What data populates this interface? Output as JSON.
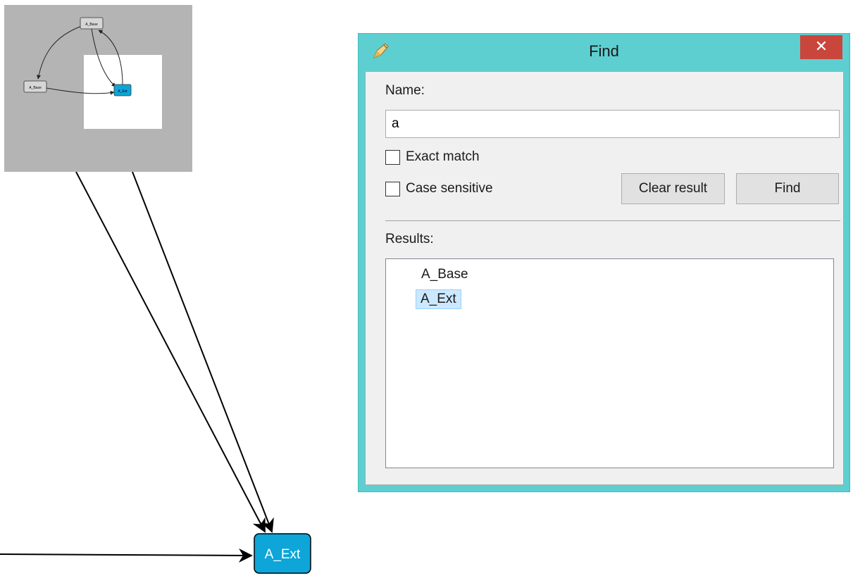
{
  "graph": {
    "main_node": {
      "label": "A_Ext",
      "color": "#0ea5d8"
    },
    "minimap": {
      "nodes": [
        {
          "label": "A_Base"
        },
        {
          "label": "A_Base"
        },
        {
          "label": "A_Ext"
        }
      ]
    }
  },
  "dialog": {
    "title": "Find",
    "close_glyph": "✕",
    "name_label": "Name:",
    "name_value": "a",
    "exact_match_label": "Exact match",
    "exact_match_checked": false,
    "case_sensitive_label": "Case sensitive",
    "case_sensitive_checked": false,
    "clear_button": "Clear result",
    "find_button": "Find",
    "results_label": "Results:",
    "results": [
      {
        "label": "A_Base",
        "selected": false
      },
      {
        "label": "A_Ext",
        "selected": true
      }
    ],
    "colors": {
      "frame": "#5ecfd0",
      "close": "#c9463d",
      "selection": "#cce8ff"
    }
  }
}
